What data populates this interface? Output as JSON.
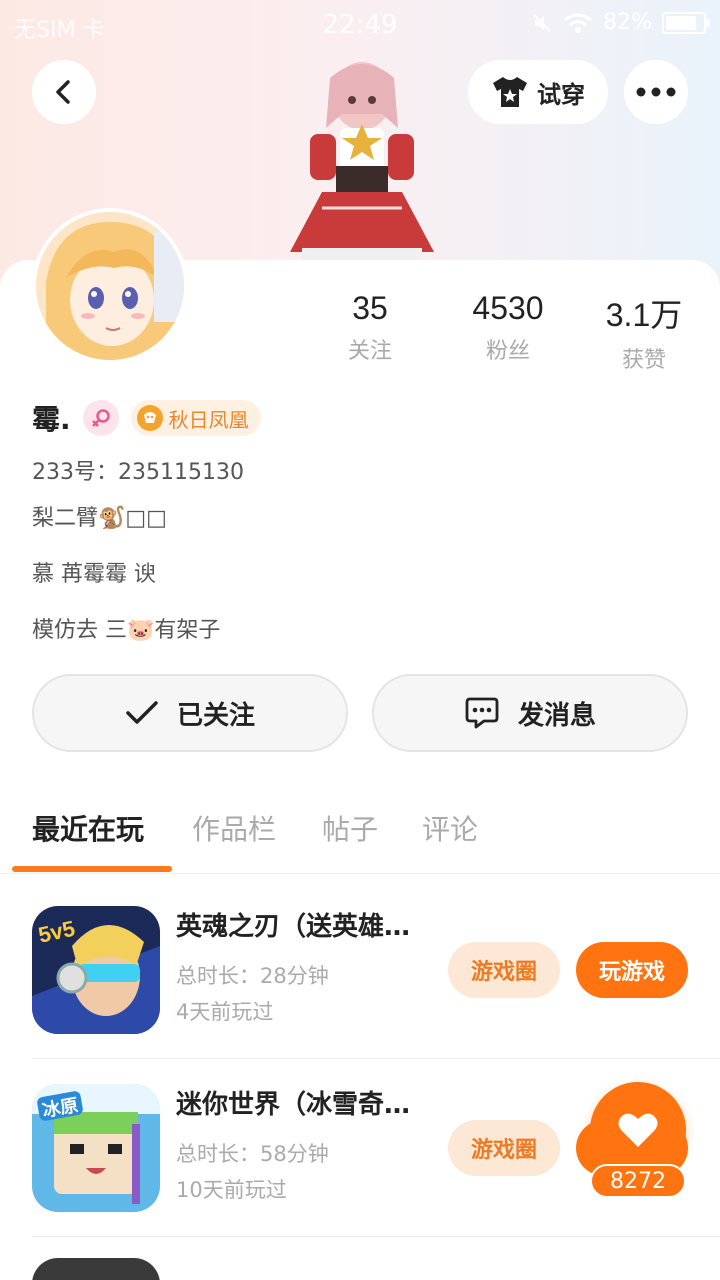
{
  "status_bar": {
    "carrier": "无SIM 卡",
    "time": "22:49",
    "battery": "82%",
    "battery_level": 0.82
  },
  "header": {
    "tryon_label": "试穿"
  },
  "profile": {
    "stats": [
      {
        "value": "35",
        "label": "关注"
      },
      {
        "value": "4530",
        "label": "粉丝"
      },
      {
        "value": "3.1万",
        "label": "获赞"
      }
    ],
    "name": "霉.",
    "title_badge": "秋日凤凰",
    "id_line": "233号：235115130",
    "bio_lines": [
      "梨二臂🐒□□",
      "慕 苒霉霉 谀",
      "模仿去 三🐷有架子"
    ]
  },
  "actions": {
    "follow_label": "已关注",
    "message_label": "发消息"
  },
  "tabs": [
    "最近在玩",
    "作品栏",
    "帖子",
    "评论"
  ],
  "games": [
    {
      "title": "英魂之刃（送英雄…",
      "duration": "总时长：28分钟",
      "last_played": "4天前玩过",
      "circle_label": "游戏圈",
      "play_label": "玩游戏"
    },
    {
      "title": "迷你世界（冰雪奇…",
      "duration": "总时长：58分钟",
      "last_played": "10天前玩过",
      "circle_label": "游戏圈",
      "play_label": "玩游戏"
    }
  ],
  "like": {
    "count": "8272"
  },
  "colors": {
    "accent": "#ff7410",
    "accent_light": "#fde8d6",
    "badge": "#e8862a"
  }
}
